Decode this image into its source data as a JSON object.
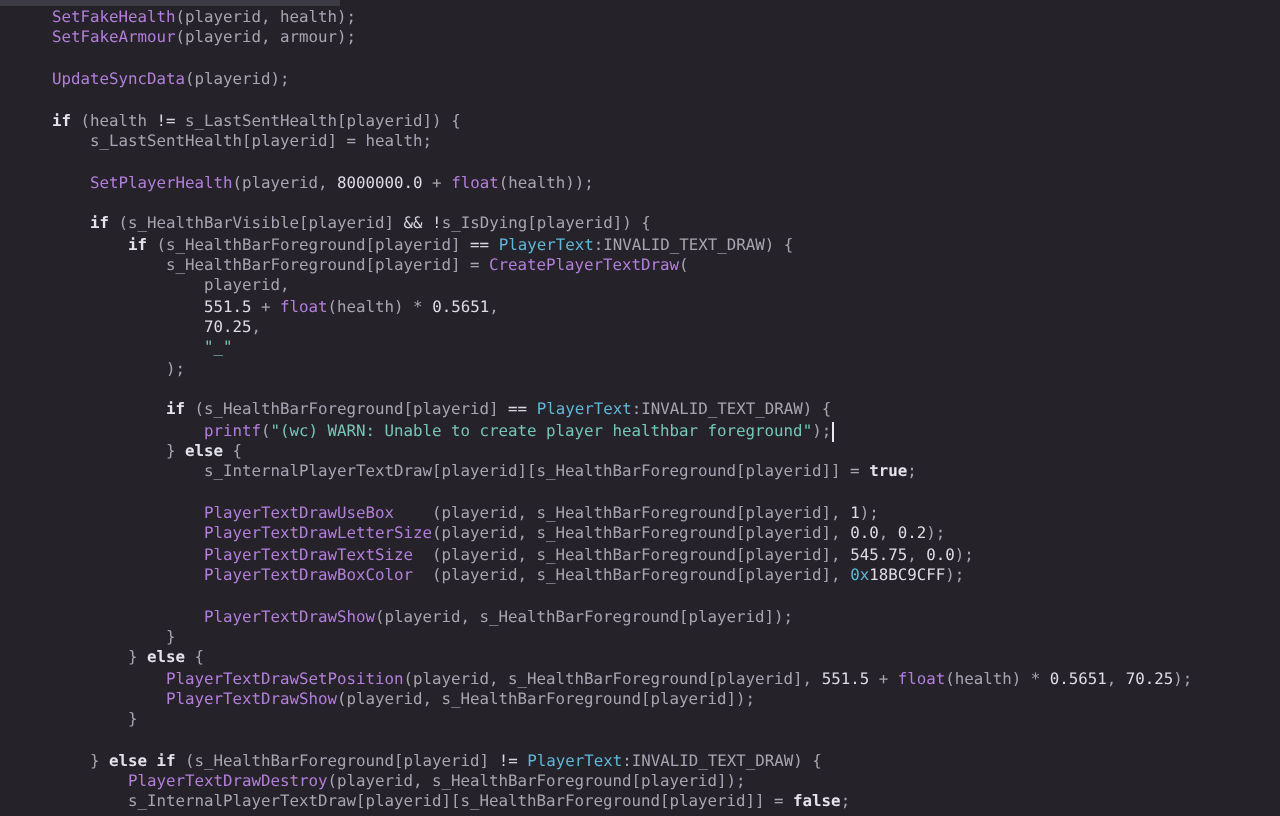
{
  "editor": {
    "lines": [
      {
        "cursor": false,
        "tokens": [
          {
            "kind": "fn",
            "text": "SetFakeHealth"
          },
          {
            "kind": "plain",
            "text": "(playerid, health);"
          }
        ]
      },
      {
        "cursor": false,
        "tokens": [
          {
            "kind": "fn",
            "text": "SetFakeArmour"
          },
          {
            "kind": "plain",
            "text": "(playerid, armour);"
          }
        ]
      },
      {
        "cursor": false
      },
      {
        "cursor": false,
        "tokens": [
          {
            "kind": "fn",
            "text": "UpdateSyncData"
          },
          {
            "kind": "plain",
            "text": "(playerid);"
          }
        ]
      },
      {
        "cursor": false
      },
      {
        "cursor": false,
        "tokens": [
          {
            "kind": "kw",
            "text": "if"
          },
          {
            "kind": "plain",
            "text": " (health "
          },
          {
            "kind": "op",
            "text": "!="
          },
          {
            "kind": "plain",
            "text": " s_LastSentHealth[playerid]) {"
          }
        ]
      },
      {
        "cursor": false,
        "tokens": [
          {
            "kind": "plain",
            "text": "    s_LastSentHealth[playerid] = health;"
          }
        ]
      },
      {
        "cursor": false
      },
      {
        "cursor": false,
        "tokens": [
          {
            "kind": "fn",
            "text": "    SetPlayerHealth"
          },
          {
            "kind": "plain",
            "text": "(playerid, "
          },
          {
            "kind": "num",
            "text": "8000000.0"
          },
          {
            "kind": "plain",
            "text": " + "
          },
          {
            "kind": "fn",
            "text": "float"
          },
          {
            "kind": "plain",
            "text": "(health));"
          }
        ]
      },
      {
        "cursor": false
      },
      {
        "cursor": false,
        "tokens": [
          {
            "kind": "kw",
            "text": "    if"
          },
          {
            "kind": "plain",
            "text": " (s_HealthBarVisible[playerid] "
          },
          {
            "kind": "op",
            "text": "&& !"
          },
          {
            "kind": "plain",
            "text": "s_IsDying[playerid]) {"
          }
        ]
      },
      {
        "cursor": false,
        "tokens": [
          {
            "kind": "kw",
            "text": "        if"
          },
          {
            "kind": "plain",
            "text": " (s_HealthBarForeground[playerid] "
          },
          {
            "kind": "op",
            "text": "== "
          },
          {
            "kind": "type",
            "text": "PlayerText"
          },
          {
            "kind": "plain",
            "text": ":INVALID_TEXT_DRAW) {"
          }
        ]
      },
      {
        "cursor": false,
        "tokens": [
          {
            "kind": "plain",
            "text": "            s_HealthBarForeground[playerid] = "
          },
          {
            "kind": "fn",
            "text": "CreatePlayerTextDraw"
          },
          {
            "kind": "plain",
            "text": "("
          }
        ]
      },
      {
        "cursor": false,
        "tokens": [
          {
            "kind": "plain",
            "text": "                playerid,"
          }
        ]
      },
      {
        "cursor": false,
        "tokens": [
          {
            "kind": "num",
            "text": "                551.5"
          },
          {
            "kind": "plain",
            "text": " + "
          },
          {
            "kind": "fn",
            "text": "float"
          },
          {
            "kind": "plain",
            "text": "(health) * "
          },
          {
            "kind": "num",
            "text": "0.5651"
          },
          {
            "kind": "plain",
            "text": ","
          }
        ]
      },
      {
        "cursor": false,
        "tokens": [
          {
            "kind": "num",
            "text": "                70.25"
          },
          {
            "kind": "plain",
            "text": ","
          }
        ]
      },
      {
        "cursor": false,
        "tokens": [
          {
            "kind": "str",
            "text": "                \"_\""
          }
        ]
      },
      {
        "cursor": false,
        "tokens": [
          {
            "kind": "plain",
            "text": "            );"
          }
        ]
      },
      {
        "cursor": false
      },
      {
        "cursor": false,
        "tokens": [
          {
            "kind": "kw",
            "text": "            if"
          },
          {
            "kind": "plain",
            "text": " (s_HealthBarForeground[playerid] "
          },
          {
            "kind": "op",
            "text": "== "
          },
          {
            "kind": "type",
            "text": "PlayerText"
          },
          {
            "kind": "plain",
            "text": ":INVALID_TEXT_DRAW) {"
          }
        ]
      },
      {
        "cursor": true,
        "tokens": [
          {
            "kind": "fn",
            "text": "                printf"
          },
          {
            "kind": "plain",
            "text": "("
          },
          {
            "kind": "str",
            "text": "\"(wc) WARN: Unable to create player healthbar foreground\""
          },
          {
            "kind": "plain",
            "text": ");"
          }
        ]
      },
      {
        "cursor": false,
        "tokens": [
          {
            "kind": "plain",
            "text": "            } "
          },
          {
            "kind": "kw",
            "text": "else"
          },
          {
            "kind": "plain",
            "text": " {"
          }
        ]
      },
      {
        "cursor": false,
        "tokens": [
          {
            "kind": "plain",
            "text": "                s_InternalPlayerTextDraw[playerid][s_HealthBarForeground[playerid]] = "
          },
          {
            "kind": "kw",
            "text": "true"
          },
          {
            "kind": "plain",
            "text": ";"
          }
        ]
      },
      {
        "cursor": false
      },
      {
        "cursor": false,
        "tokens": [
          {
            "kind": "fn",
            "text": "                PlayerTextDrawUseBox"
          },
          {
            "kind": "plain",
            "text": "    (playerid, s_HealthBarForeground[playerid], "
          },
          {
            "kind": "num",
            "text": "1"
          },
          {
            "kind": "plain",
            "text": ");"
          }
        ]
      },
      {
        "cursor": false,
        "tokens": [
          {
            "kind": "fn",
            "text": "                PlayerTextDrawLetterSize"
          },
          {
            "kind": "plain",
            "text": "(playerid, s_HealthBarForeground[playerid], "
          },
          {
            "kind": "num",
            "text": "0.0"
          },
          {
            "kind": "plain",
            "text": ", "
          },
          {
            "kind": "num",
            "text": "0.2"
          },
          {
            "kind": "plain",
            "text": ");"
          }
        ]
      },
      {
        "cursor": false,
        "tokens": [
          {
            "kind": "fn",
            "text": "                PlayerTextDrawTextSize"
          },
          {
            "kind": "plain",
            "text": "  (playerid, s_HealthBarForeground[playerid], "
          },
          {
            "kind": "num",
            "text": "545.75"
          },
          {
            "kind": "plain",
            "text": ", "
          },
          {
            "kind": "num",
            "text": "0.0"
          },
          {
            "kind": "plain",
            "text": ");"
          }
        ]
      },
      {
        "cursor": false,
        "tokens": [
          {
            "kind": "fn",
            "text": "                PlayerTextDrawBoxColor"
          },
          {
            "kind": "plain",
            "text": "  (playerid, s_HealthBarForeground[playerid], "
          },
          {
            "kind": "type",
            "text": "0x"
          },
          {
            "kind": "num",
            "text": "18BC9CFF"
          },
          {
            "kind": "plain",
            "text": ");"
          }
        ]
      },
      {
        "cursor": false
      },
      {
        "cursor": false,
        "tokens": [
          {
            "kind": "fn",
            "text": "                PlayerTextDrawShow"
          },
          {
            "kind": "plain",
            "text": "(playerid, s_HealthBarForeground[playerid]);"
          }
        ]
      },
      {
        "cursor": false,
        "tokens": [
          {
            "kind": "plain",
            "text": "            }"
          }
        ]
      },
      {
        "cursor": false,
        "tokens": [
          {
            "kind": "plain",
            "text": "        } "
          },
          {
            "kind": "kw",
            "text": "else"
          },
          {
            "kind": "plain",
            "text": " {"
          }
        ]
      },
      {
        "cursor": false,
        "tokens": [
          {
            "kind": "fn",
            "text": "            PlayerTextDrawSetPosition"
          },
          {
            "kind": "plain",
            "text": "(playerid, s_HealthBarForeground[playerid], "
          },
          {
            "kind": "num",
            "text": "551.5"
          },
          {
            "kind": "plain",
            "text": " + "
          },
          {
            "kind": "fn",
            "text": "float"
          },
          {
            "kind": "plain",
            "text": "(health) * "
          },
          {
            "kind": "num",
            "text": "0.5651"
          },
          {
            "kind": "plain",
            "text": ", "
          },
          {
            "kind": "num",
            "text": "70.25"
          },
          {
            "kind": "plain",
            "text": ");"
          }
        ]
      },
      {
        "cursor": false,
        "tokens": [
          {
            "kind": "fn",
            "text": "            PlayerTextDrawShow"
          },
          {
            "kind": "plain",
            "text": "(playerid, s_HealthBarForeground[playerid]);"
          }
        ]
      },
      {
        "cursor": false,
        "tokens": [
          {
            "kind": "plain",
            "text": "        }"
          }
        ]
      },
      {
        "cursor": false
      },
      {
        "cursor": false,
        "tokens": [
          {
            "kind": "plain",
            "text": "    } "
          },
          {
            "kind": "kw",
            "text": "else if"
          },
          {
            "kind": "plain",
            "text": " (s_HealthBarForeground[playerid] "
          },
          {
            "kind": "op",
            "text": "!= "
          },
          {
            "kind": "type",
            "text": "PlayerText"
          },
          {
            "kind": "plain",
            "text": ":INVALID_TEXT_DRAW) {"
          }
        ]
      },
      {
        "cursor": false,
        "tokens": [
          {
            "kind": "fn",
            "text": "        PlayerTextDrawDestroy"
          },
          {
            "kind": "plain",
            "text": "(playerid, s_HealthBarForeground[playerid]);"
          }
        ]
      },
      {
        "cursor": false,
        "tokens": [
          {
            "kind": "plain",
            "text": "        s_InternalPlayerTextDraw[playerid][s_HealthBarForeground[playerid]] = "
          },
          {
            "kind": "kw",
            "text": "false"
          },
          {
            "kind": "plain",
            "text": ";"
          }
        ]
      }
    ]
  }
}
